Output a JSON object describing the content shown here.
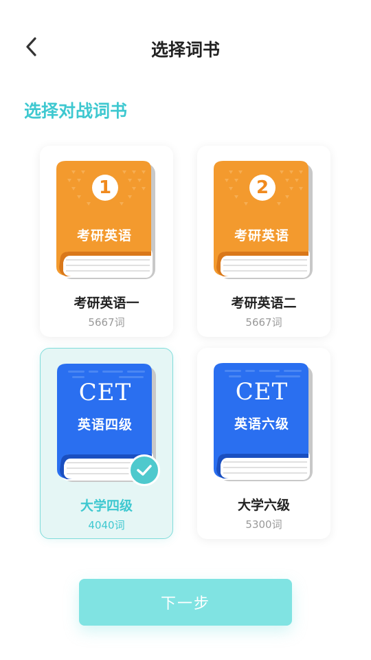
{
  "header": {
    "title": "选择词书",
    "back_icon": "chevron-left-icon"
  },
  "section": {
    "title": "选择对战词书"
  },
  "books": [
    {
      "name": "考研英语一",
      "count": "5667词",
      "cover_text": "考研英语",
      "badge": "1",
      "style": "orange",
      "selected": false
    },
    {
      "name": "考研英语二",
      "count": "5667词",
      "cover_text": "考研英语",
      "badge": "2",
      "style": "orange",
      "selected": false
    },
    {
      "name": "大学四级",
      "count": "4040词",
      "cover_title": "CET",
      "cover_text": "英语四级",
      "style": "blue",
      "selected": true
    },
    {
      "name": "大学六级",
      "count": "5300词",
      "cover_title": "CET",
      "cover_text": "英语六级",
      "style": "blue",
      "selected": false
    }
  ],
  "next_button": {
    "label": "下一步"
  },
  "colors": {
    "accent": "#3ec8d0",
    "button": "#80e3e2",
    "orange": "#f39a2e",
    "blue": "#2a6ff0"
  }
}
